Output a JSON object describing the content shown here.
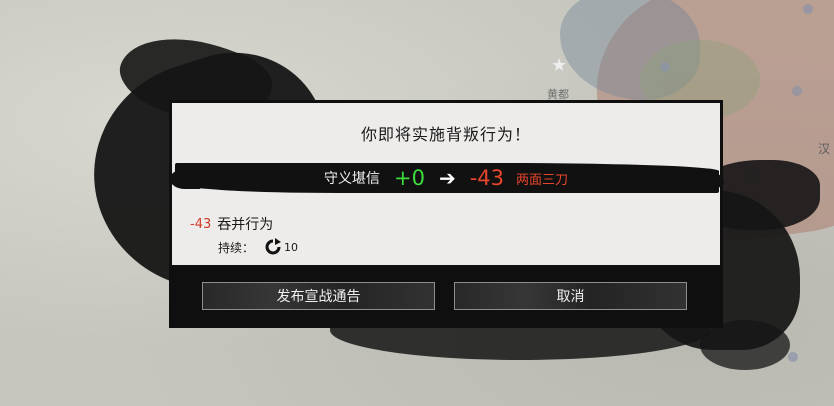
{
  "map": {
    "city_label": "黄都",
    "edge_label": "汉"
  },
  "dialog": {
    "title": "你即将实施背叛行为！",
    "stat": {
      "label": "守义堪信",
      "from": "+0",
      "to": "-43",
      "tag": "两面三刀"
    },
    "reason": {
      "value": "-43",
      "label": "吞并行为"
    },
    "duration": {
      "label": "持续：",
      "value": "10"
    },
    "buttons": {
      "confirm": "发布宣战通告",
      "cancel": "取消"
    }
  },
  "colors": {
    "positive": "#3ddc3d",
    "negative": "#e8452c",
    "panel": "#eeeceb",
    "ink": "#111111"
  },
  "icons": {
    "arrow": "arrow-right-icon",
    "duration": "cycle-turns-icon",
    "map_marker": "star-icon"
  }
}
